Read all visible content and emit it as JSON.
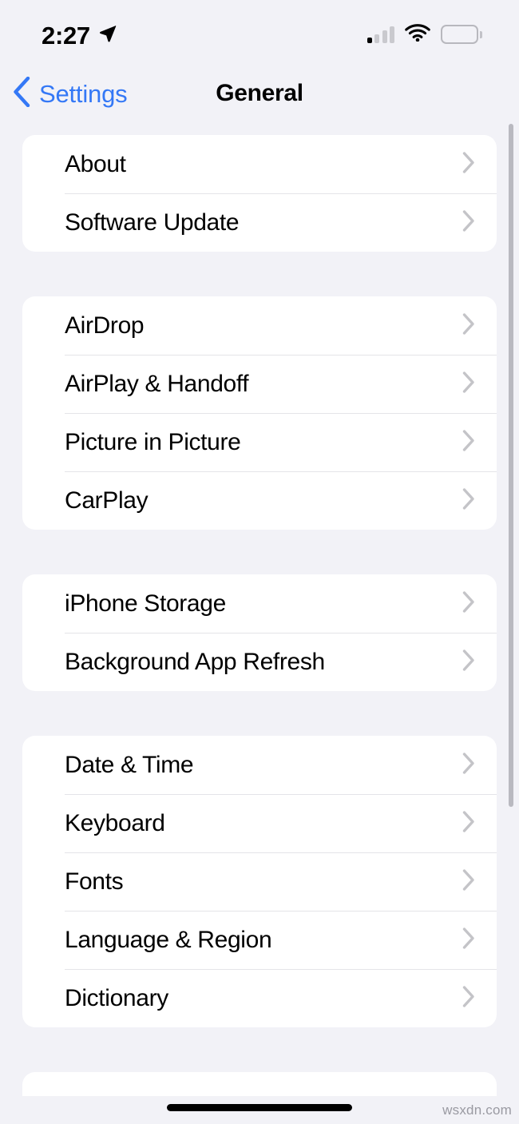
{
  "status_bar": {
    "time": "2:27",
    "location_icon": "location-arrow-icon",
    "cellular_icon": "cellular-signal-icon",
    "cellular_bars_filled": 1,
    "cellular_bars_total": 4,
    "wifi_icon": "wifi-icon",
    "battery_icon": "battery-icon",
    "battery_level_percent": 100
  },
  "nav": {
    "back_label": "Settings",
    "back_icon": "chevron-left-icon",
    "title": "General"
  },
  "colors": {
    "background": "#f2f2f7",
    "card": "#ffffff",
    "accent_blue": "#3478f6",
    "separator": "#e4e4e8",
    "chevron_gray": "#c4c4c8",
    "label_black": "#000000"
  },
  "groups": [
    {
      "rows": [
        {
          "label": "About",
          "accessory": "chevron-right-icon"
        },
        {
          "label": "Software Update",
          "accessory": "chevron-right-icon"
        }
      ]
    },
    {
      "rows": [
        {
          "label": "AirDrop",
          "accessory": "chevron-right-icon"
        },
        {
          "label": "AirPlay & Handoff",
          "accessory": "chevron-right-icon"
        },
        {
          "label": "Picture in Picture",
          "accessory": "chevron-right-icon"
        },
        {
          "label": "CarPlay",
          "accessory": "chevron-right-icon"
        }
      ]
    },
    {
      "rows": [
        {
          "label": "iPhone Storage",
          "accessory": "chevron-right-icon"
        },
        {
          "label": "Background App Refresh",
          "accessory": "chevron-right-icon"
        }
      ]
    },
    {
      "rows": [
        {
          "label": "Date & Time",
          "accessory": "chevron-right-icon"
        },
        {
          "label": "Keyboard",
          "accessory": "chevron-right-icon"
        },
        {
          "label": "Fonts",
          "accessory": "chevron-right-icon"
        },
        {
          "label": "Language & Region",
          "accessory": "chevron-right-icon"
        },
        {
          "label": "Dictionary",
          "accessory": "chevron-right-icon"
        }
      ]
    }
  ],
  "watermark": "wsxdn.com"
}
